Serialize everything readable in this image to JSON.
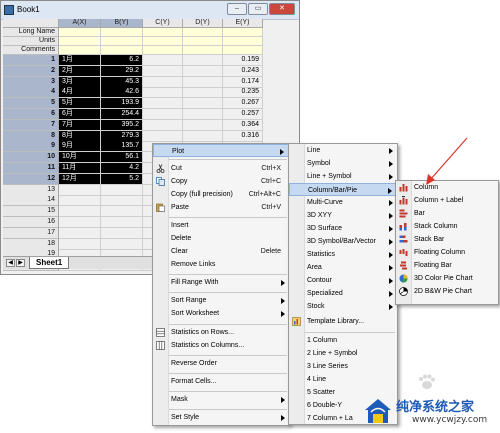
{
  "window": {
    "title": "Book1",
    "buttons": {
      "minimize": "–",
      "maximize": "▭",
      "close": "✕"
    }
  },
  "columns": [
    "A(X)",
    "B(Y)",
    "C(Y)",
    "D(Y)",
    "E(Y)"
  ],
  "meta_rows": [
    "Long Name",
    "Units",
    "Comments"
  ],
  "data_rows": [
    {
      "n": "1",
      "a": "1月",
      "b": "6.2",
      "e": "0.159"
    },
    {
      "n": "2",
      "a": "2月",
      "b": "29.2",
      "e": "0.243"
    },
    {
      "n": "3",
      "a": "3月",
      "b": "45.3",
      "e": "0.174"
    },
    {
      "n": "4",
      "a": "4月",
      "b": "42.6",
      "e": "0.235"
    },
    {
      "n": "5",
      "a": "5月",
      "b": "193.9",
      "e": "0.267"
    },
    {
      "n": "6",
      "a": "6月",
      "b": "254.4",
      "e": "0.257"
    },
    {
      "n": "7",
      "a": "7月",
      "b": "395.2",
      "e": "0.364"
    },
    {
      "n": "8",
      "a": "8月",
      "b": "279.3",
      "e": "0.316"
    },
    {
      "n": "9",
      "a": "9月",
      "b": "135.7",
      "e": ""
    },
    {
      "n": "10",
      "a": "10月",
      "b": "56.1",
      "e": ""
    },
    {
      "n": "11",
      "a": "11月",
      "b": "4.2",
      "e": ""
    },
    {
      "n": "12",
      "a": "12月",
      "b": "5.2",
      "e": ""
    },
    {
      "n": "13",
      "a": "",
      "b": "",
      "e": ""
    },
    {
      "n": "14",
      "a": "",
      "b": "",
      "e": ""
    },
    {
      "n": "15",
      "a": "",
      "b": "",
      "e": ""
    },
    {
      "n": "16",
      "a": "",
      "b": "",
      "e": ""
    },
    {
      "n": "17",
      "a": "",
      "b": "",
      "e": ""
    },
    {
      "n": "18",
      "a": "",
      "b": "",
      "e": ""
    },
    {
      "n": "19",
      "a": "",
      "b": "",
      "e": ""
    },
    {
      "n": "20",
      "a": "",
      "b": "",
      "e": ""
    }
  ],
  "sheet_tab": "Sheet1",
  "context_menu": {
    "plot": "Plot",
    "cut": "Cut",
    "cut_sc": "Ctrl+X",
    "copy": "Copy",
    "copy_sc": "Ctrl+C",
    "copy_full": "Copy (full precision)",
    "copy_full_sc": "Ctrl+Alt+C",
    "paste": "Paste",
    "paste_sc": "Ctrl+V",
    "insert": "Insert",
    "delete": "Delete",
    "clear": "Clear",
    "clear_sc": "Delete",
    "remove_links": "Remove Links",
    "fill_range": "Fill Range With",
    "sort_range": "Sort Range",
    "sort_worksheet": "Sort Worksheet",
    "stats_rows": "Statistics on Rows...",
    "stats_cols": "Statistics on Columns...",
    "reverse_order": "Reverse Order",
    "format_cells": "Format Cells...",
    "mask": "Mask",
    "set_style": "Set Style"
  },
  "plot_menu": {
    "line": "Line",
    "symbol": "Symbol",
    "line_symbol": "Line + Symbol",
    "column_bar_pie": "Column/Bar/Pie",
    "multi_curve": "Multi-Curve",
    "xyy_3d": "3D XYY",
    "surface_3d": "3D Surface",
    "symbol_bar_vector_3d": "3D Symbol/Bar/Vector",
    "statistics": "Statistics",
    "area": "Area",
    "contour": "Contour",
    "specialized": "Specialized",
    "stock": "Stock",
    "template_library": "Template Library...",
    "t1": "1 Column",
    "t2": "2 Line + Symbol",
    "t3": "3 Line Series",
    "t4": "4 Line",
    "t5": "5 Scatter",
    "t6": "6 Double-Y",
    "t7": "7 Column + La"
  },
  "column_menu": {
    "column": "Column",
    "column_label": "Column + Label",
    "bar": "Bar",
    "stack_column": "Stack Column",
    "stack_bar": "Stack Bar",
    "floating_column": "Floating Column",
    "floating_bar": "Floating Bar",
    "pie_3d_color": "3D Color Pie Chart",
    "pie_2d_bw": "2D B&W Pie Chart"
  },
  "watermark": {
    "brand": "纯净系统之家",
    "url": "www.ycwjzy.com"
  },
  "colors": {
    "highlight": "#c5d9f1",
    "selection": "#000000",
    "meta_bg": "#ffffd8",
    "arrow": "#d9362b",
    "brand": "#1e5bb8"
  }
}
